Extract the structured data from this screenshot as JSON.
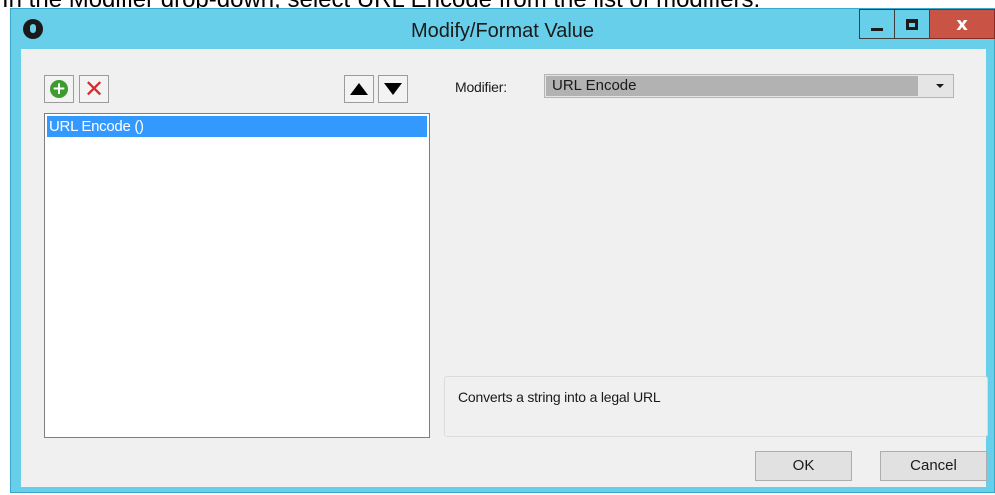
{
  "instruction": {
    "text": "In the Modifier drop-down, select URL Encode from the list of modifiers."
  },
  "window": {
    "title": "Modify/Format Value",
    "controls": {
      "minimize_icon": "minimize-icon",
      "maximize_icon": "maximize-icon",
      "close_label": "x"
    }
  },
  "toolbar": {
    "add_icon": "add-icon",
    "add_glyph": "+",
    "remove_icon": "remove-icon",
    "remove_glyph": "✕",
    "move_up_icon": "arrow-up-icon",
    "move_down_icon": "arrow-down-icon"
  },
  "modifier_list": {
    "items": [
      {
        "label": "URL Encode ()",
        "selected": true
      }
    ]
  },
  "modifier": {
    "label": "Modifier:",
    "selected_value": "URL Encode"
  },
  "description": {
    "text": "Converts a string into a legal URL"
  },
  "buttons": {
    "ok_label": "OK",
    "cancel_label": "Cancel"
  },
  "colors": {
    "titlebar": "#68cfea",
    "close_button": "#c95445",
    "selection": "#3399ff",
    "add_icon": "#3e9c2f",
    "remove_icon": "#d82c2c"
  }
}
